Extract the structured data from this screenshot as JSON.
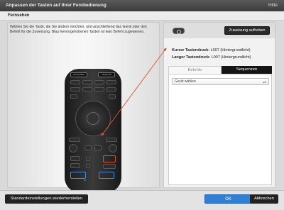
{
  "window": {
    "title": "Anpassen der Tasten auf Ihrer Fernbedienung",
    "help": "Hilfe"
  },
  "section": {
    "title": "Fernsehen"
  },
  "instructions": "Wählen Sie die Taste, die Sie ändern möchten, und anschließend das Gerät oder den Befehl für die Zuweisung. Blau hervorgehobenen Tasten ist kein Befehl zugewiesen.",
  "remote": {
    "top_buttons": [
      "ACTIVITIES",
      "DEVICES"
    ]
  },
  "assign": {
    "button": "Zuweisung aufheben",
    "short_label": "Kurzer Tastendruck:",
    "short_value": "L007 (Hintergrundlicht)",
    "long_label": "Langer Tastendruck:",
    "long_value": "L007 (Hintergrundlicht)"
  },
  "tabs": [
    "Befehle",
    "Sequenzen"
  ],
  "select": {
    "value": "Gerät wählen"
  },
  "footer": {
    "reset": "Standardeinstellungen wiederherstellen",
    "ok": "OK",
    "cancel": "Abbrechen"
  },
  "colors": {
    "accent_blue": "#2f7fd6",
    "highlight_red": "#e0512f",
    "unassigned_blue": "#3a8ee8"
  }
}
